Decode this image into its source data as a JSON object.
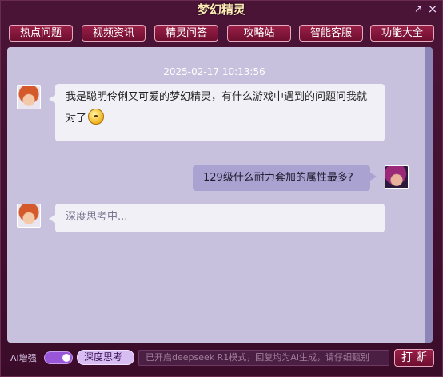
{
  "window": {
    "title": "梦幻精灵",
    "restore_glyph": "↗",
    "close_glyph": "×"
  },
  "nav": {
    "tabs": [
      {
        "label": "热点问题"
      },
      {
        "label": "视频资讯"
      },
      {
        "label": "精灵问答"
      },
      {
        "label": "攻略站"
      },
      {
        "label": "智能客服"
      },
      {
        "label": "功能大全"
      }
    ]
  },
  "chat": {
    "timestamp": "2025-02-17 10:13:56",
    "messages": [
      {
        "sender": "bot",
        "text": "我是聪明伶俐又可爱的梦幻精灵，有什么游戏中遇到的问题问我就对了"
      },
      {
        "sender": "user",
        "text": "129级什么耐力套加的属性最多?"
      },
      {
        "sender": "bot",
        "text": "深度思考中..."
      }
    ]
  },
  "bottom": {
    "ai_label": "AI增强",
    "deep_button_label": "深度思考",
    "input_placeholder": "已开启deepseek R1模式，回复均为AI生成，请仔细甄别",
    "send_label": "打断"
  },
  "colors": {
    "accent": "#8a1a3f",
    "panel": "#c7c1dd",
    "user_bubble": "#aaa2d1",
    "bot_bubble": "#f2f0f7"
  }
}
